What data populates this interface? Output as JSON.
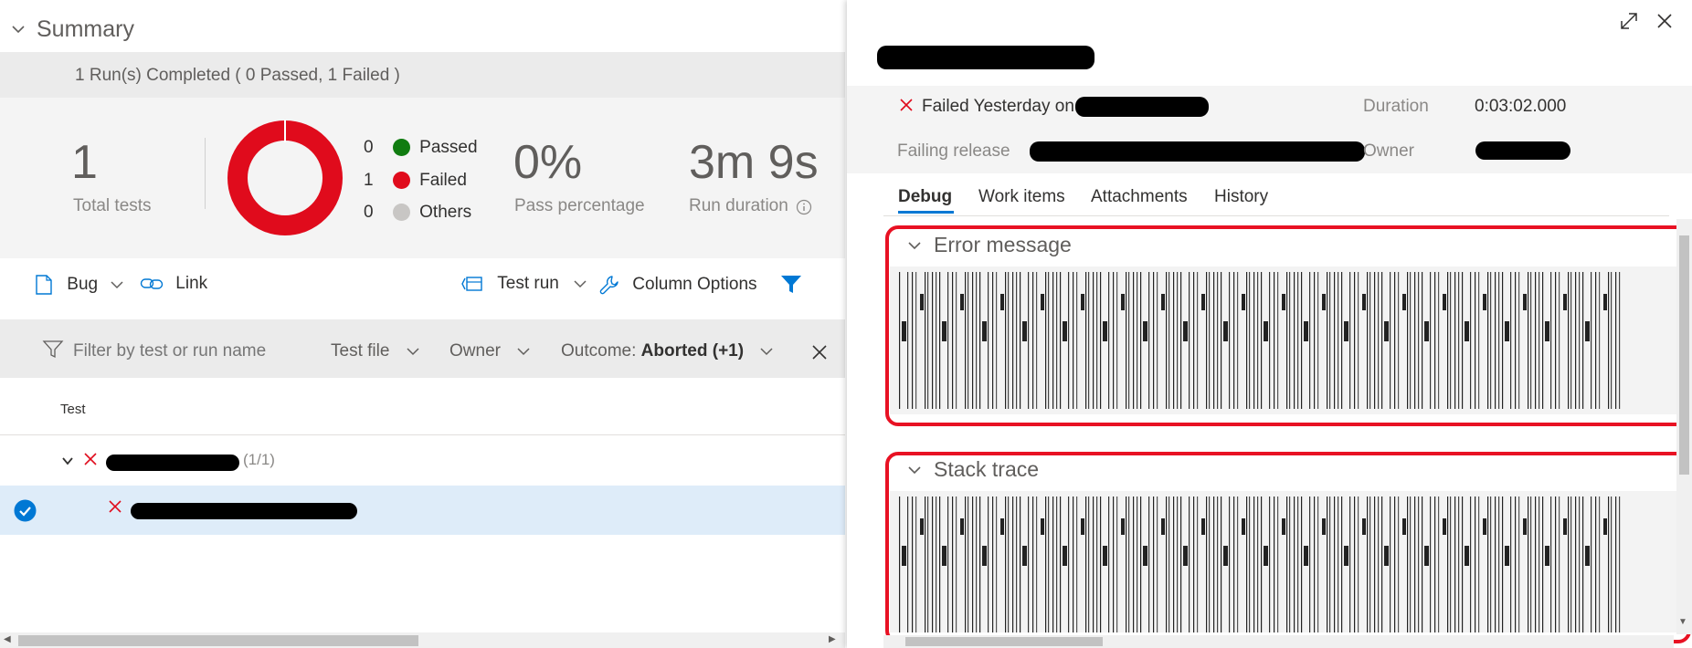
{
  "summary": {
    "title": "Summary",
    "runs_completed": "1 Run(s) Completed ( 0 Passed, 1 Failed )",
    "total_tests_value": "1",
    "total_tests_label": "Total tests",
    "legend": [
      {
        "count": "0",
        "label": "Passed",
        "color": "#107c10"
      },
      {
        "count": "1",
        "label": "Failed",
        "color": "#e00b1c"
      },
      {
        "count": "0",
        "label": "Others",
        "color": "#c8c6c4"
      }
    ],
    "pass_percentage_value": "0%",
    "pass_percentage_label": "Pass percentage",
    "run_duration_value": "3m 9s",
    "run_duration_label": "Run duration"
  },
  "toolbar": {
    "bug_label": "Bug",
    "link_label": "Link",
    "test_run_label": "Test run",
    "column_options_label": "Column Options"
  },
  "filters": {
    "search_placeholder": "Filter by test or run name",
    "test_file_label": "Test file",
    "owner_label": "Owner",
    "outcome_label": "Outcome:",
    "outcome_value": "Aborted (+1)"
  },
  "table": {
    "column_test": "Test",
    "group_count": "(1/1)"
  },
  "detail": {
    "status_text": "Failed Yesterday on",
    "duration_label": "Duration",
    "duration_value": "0:03:02.000",
    "failing_release_label": "Failing release",
    "owner_label": "Owner",
    "tabs": [
      "Debug",
      "Work items",
      "Attachments",
      "History"
    ],
    "error_message_title": "Error message",
    "stack_trace_title": "Stack trace"
  },
  "colors": {
    "accent": "#0078d4",
    "failed_red": "#e00b1c",
    "highlight_red": "#e81123"
  }
}
